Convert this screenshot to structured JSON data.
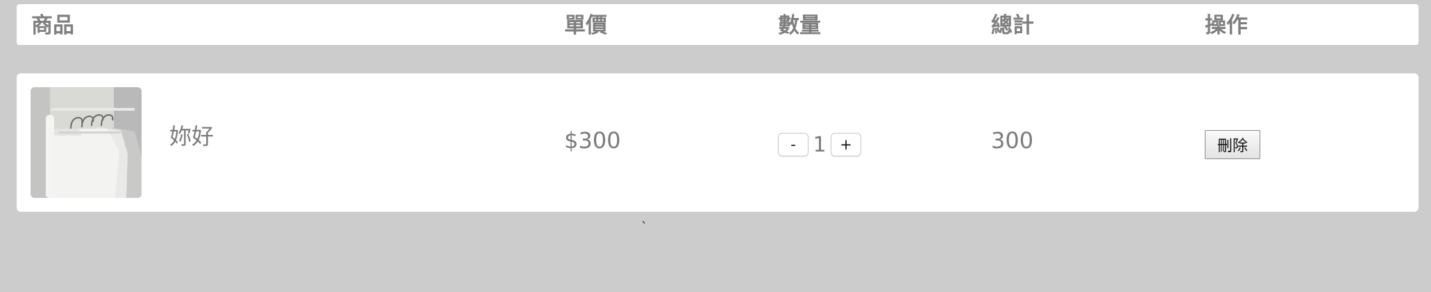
{
  "table_header": {
    "product": "商品",
    "unit_price": "單價",
    "quantity": "數量",
    "total": "總計",
    "action": "操作"
  },
  "cart_items": [
    {
      "image_icon": "white-tshirts-on-hangers-photo",
      "name": "妳好",
      "unit_price": "$300",
      "quantity_decrement_label": "-",
      "quantity": "1",
      "quantity_increment_label": "+",
      "total": "300",
      "delete_label": "刪除"
    }
  ],
  "stray_mark": "`",
  "colors": {
    "page_background": "#cccccc",
    "panel_background": "#ffffff",
    "text_gray": "#808080"
  }
}
